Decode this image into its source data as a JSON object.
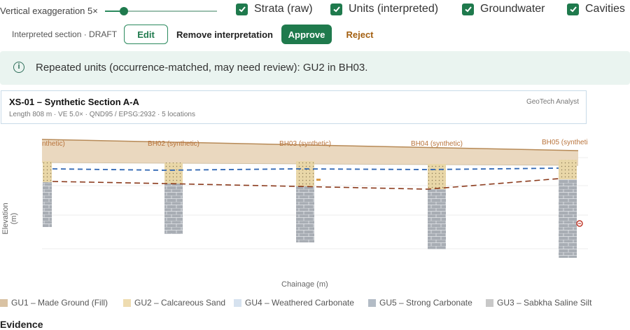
{
  "controls": {
    "ve_label": "Vertical exaggeration 5×",
    "checkboxes": [
      {
        "label": "Strata (raw)"
      },
      {
        "label": "Units (interpreted)"
      },
      {
        "label": "Groundwater"
      },
      {
        "label": "Cavities"
      }
    ]
  },
  "section_bar": {
    "label": "Interpreted section · DRAFT",
    "edit": "Edit",
    "remove": "Remove interpretation",
    "approve": "Approve",
    "reject": "Reject"
  },
  "banner": {
    "icon": "i",
    "text": "Repeated units (occurrence-matched, may need review): GU2 in BH03."
  },
  "card": {
    "title": "XS-01 – Synthetic Section A-A",
    "subtitle": "Length 808 m · VE 5.0× · QND95 / EPSG:2932 · 5 locations",
    "author": "GeoTech Analyst"
  },
  "chart": {
    "ylabel": "Elevation (m)",
    "xlabel": "Chainage (m)",
    "boreholes": [
      {
        "label": "nthetic)"
      },
      {
        "label": "BH02 (synthetic)"
      },
      {
        "label": "BH03 (synthetic)"
      },
      {
        "label": "BH04 (synthetic)"
      },
      {
        "label": "BH05 (syntheti"
      }
    ]
  },
  "legend": [
    {
      "label": "GU1 – Made Ground (Fill)",
      "color": "#d9c2a3"
    },
    {
      "label": "GU2 – Calcareous Sand",
      "color": "#eedcb0"
    },
    {
      "label": "GU4 – Weathered Carbonate",
      "color": "#d6e2ef"
    },
    {
      "label": "GU5 – Strong Carbonate",
      "color": "#b3bcc6"
    },
    {
      "label": "GU3 – Sabkha Saline Silt",
      "color": "#c8c8c8"
    }
  ],
  "next_heading": "Evidence"
}
